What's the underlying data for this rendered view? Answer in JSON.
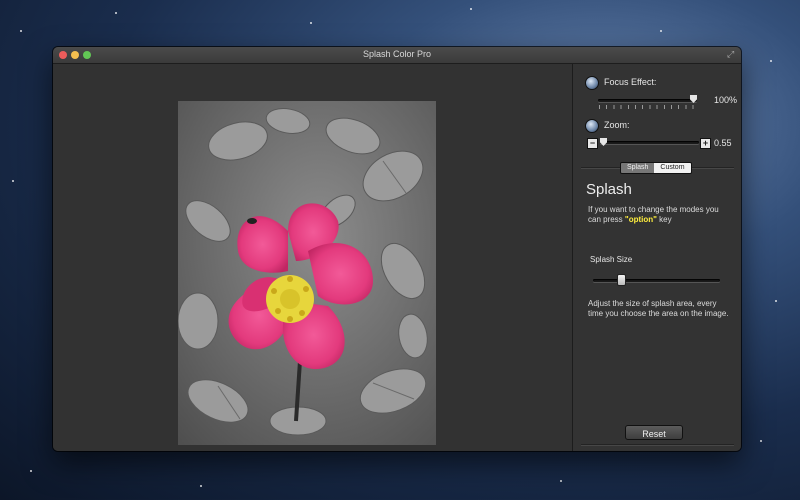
{
  "window": {
    "title": "Splash Color Pro"
  },
  "focus_effect": {
    "label": "Focus Effect:",
    "value": "100%",
    "level": 1.0
  },
  "zoom": {
    "label": "Zoom:",
    "value": "0.55",
    "level": 0.0,
    "minus": "−",
    "plus": "+"
  },
  "mode_tabs": {
    "splash": "Splash",
    "custom": "Custom",
    "selected": "Splash"
  },
  "splash_panel": {
    "heading": "Splash",
    "help_pre": "If you want to change the modes you can press ",
    "help_key": "\"option\"",
    "help_post": " key",
    "size_label": "Splash Size",
    "size_level": 0.2,
    "size_help": "Adjust the size of splash area, every time you choose the area on the image."
  },
  "reset_label": "Reset",
  "colors": {
    "flower": "#e33a7d",
    "flower_center": "#e7d63c",
    "foliage": "#7a7a7a"
  }
}
